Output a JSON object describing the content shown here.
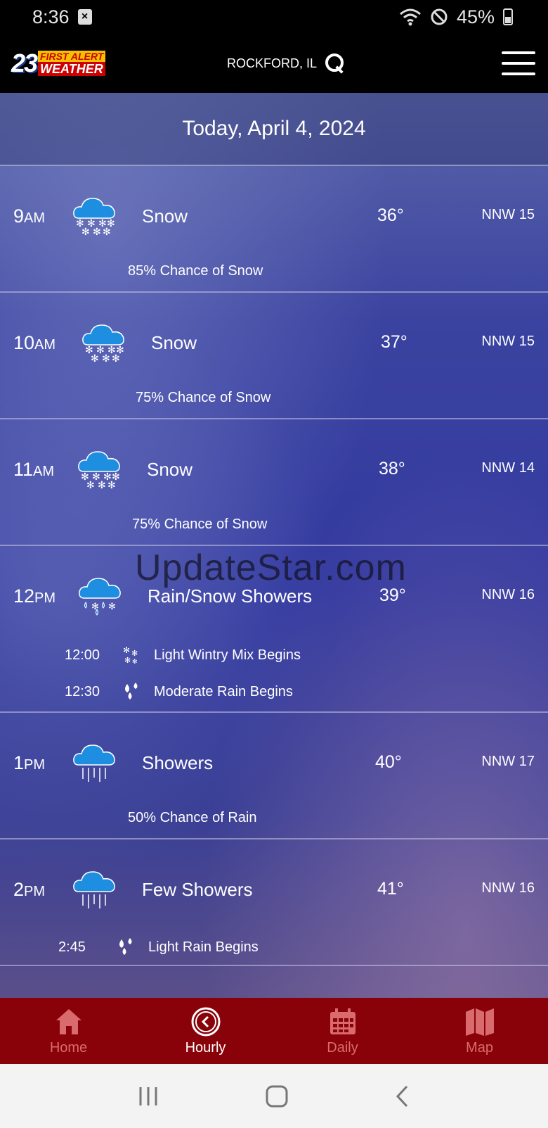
{
  "status_bar": {
    "time": "8:36",
    "battery": "45%"
  },
  "header": {
    "logo_number": "23",
    "logo_first_alert": "FIRST ALERT",
    "logo_weather": "WEATHER",
    "location": "ROCKFORD, IL"
  },
  "date_title": "Today, April 4, 2024",
  "hours": [
    {
      "hour": "9",
      "ampm": "AM",
      "condition": "Snow",
      "temp": "36°",
      "wind": "NNW 15",
      "chance": "85% Chance of Snow",
      "icon": "snow-cloud-icon"
    },
    {
      "hour": "10",
      "ampm": "AM",
      "condition": "Snow",
      "temp": "37°",
      "wind": "NNW 15",
      "chance": "75% Chance of Snow",
      "icon": "snow-cloud-icon"
    },
    {
      "hour": "11",
      "ampm": "AM",
      "condition": "Snow",
      "temp": "38°",
      "wind": "NNW 14",
      "chance": "75% Chance of Snow",
      "icon": "snow-cloud-icon"
    },
    {
      "hour": "12",
      "ampm": "PM",
      "condition": "Rain/Snow Showers",
      "temp": "39°",
      "wind": "NNW 16",
      "icon": "rain-snow-cloud-icon",
      "events": [
        {
          "time": "12:00",
          "label": "Light Wintry Mix Begins",
          "icon": "wintry-mix-icon"
        },
        {
          "time": "12:30",
          "label": "Moderate Rain Begins",
          "icon": "raindrops-icon"
        }
      ]
    },
    {
      "hour": "1",
      "ampm": "PM",
      "condition": "Showers",
      "temp": "40°",
      "wind": "NNW 17",
      "chance": "50% Chance of Rain",
      "icon": "showers-cloud-icon"
    },
    {
      "hour": "2",
      "ampm": "PM",
      "condition": "Few Showers",
      "temp": "41°",
      "wind": "NNW 16",
      "icon": "showers-cloud-icon",
      "events": [
        {
          "time": "2:45",
          "label": "Light Rain Begins",
          "icon": "raindrops-icon"
        }
      ]
    }
  ],
  "watermark": "UpdateStar.com",
  "tabs": [
    {
      "label": "Home",
      "icon": "home-icon"
    },
    {
      "label": "Hourly",
      "icon": "clock-icon",
      "active": true
    },
    {
      "label": "Daily",
      "icon": "calendar-icon"
    },
    {
      "label": "Map",
      "icon": "map-icon"
    }
  ],
  "colors": {
    "tab_bar": "#8a0209",
    "tab_inactive": "#d96b6f",
    "cloud": "#1e8fe0"
  }
}
